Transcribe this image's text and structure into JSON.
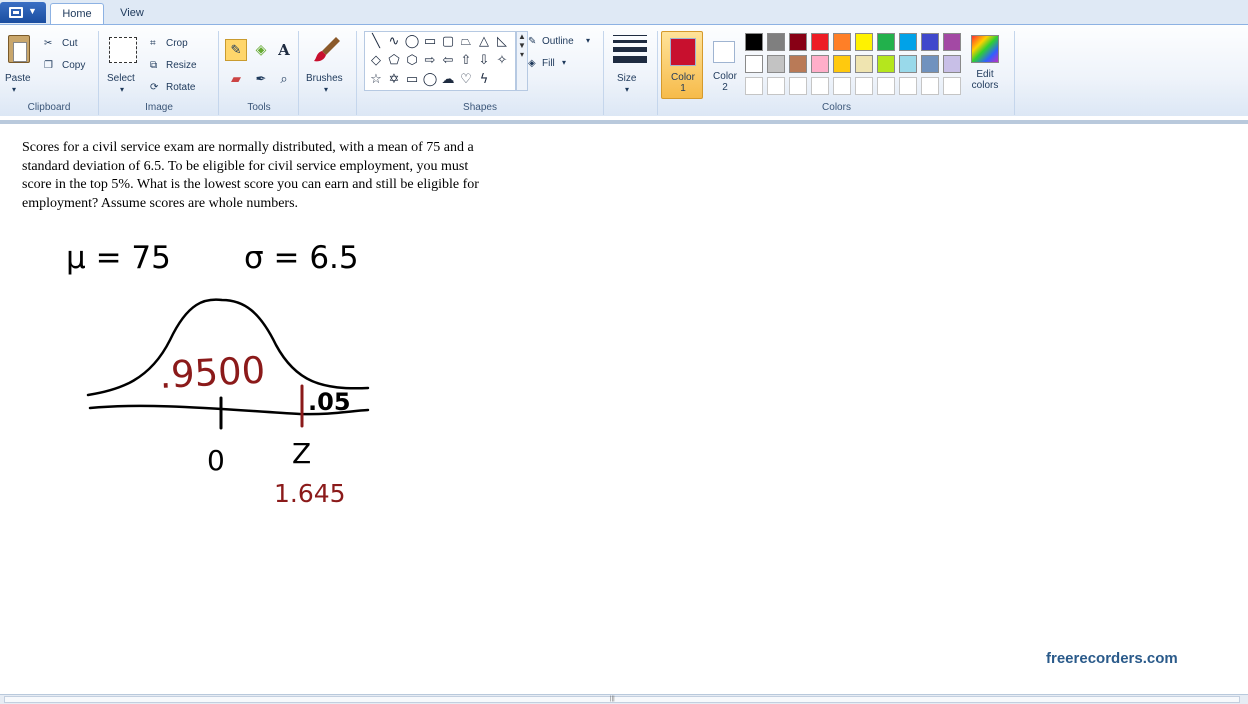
{
  "ribbon": {
    "tabs": {
      "home": "Home",
      "view": "View"
    },
    "clipboard": {
      "group_label": "Clipboard",
      "paste": "Paste",
      "cut": "Cut",
      "copy": "Copy"
    },
    "image": {
      "group_label": "Image",
      "select": "Select",
      "crop": "Crop",
      "resize": "Resize",
      "rotate": "Rotate"
    },
    "tools": {
      "group_label": "Tools",
      "text_tool": "A"
    },
    "brushes": {
      "label": "Brushes"
    },
    "shapes": {
      "group_label": "Shapes",
      "outline": "Outline",
      "fill": "Fill"
    },
    "size": {
      "label": "Size"
    },
    "colors": {
      "group_label": "Colors",
      "color1_label": "Color 1",
      "color2_label": "Color 2",
      "edit_colors": "Edit colors",
      "color1": "#c8102e",
      "color2": "#ffffff",
      "palette_row1": [
        "#000000",
        "#7f7f7f",
        "#880015",
        "#ed1c24",
        "#ff7f27",
        "#fff200",
        "#22b14c",
        "#00a2e8",
        "#3f48cc",
        "#a349a4"
      ],
      "palette_row2": [
        "#ffffff",
        "#c3c3c3",
        "#b97a57",
        "#ffaec9",
        "#ffc90e",
        "#efe4b0",
        "#b5e61d",
        "#99d9ea",
        "#7092be",
        "#c8bfe7"
      ]
    }
  },
  "canvas": {
    "problem_text": "Scores for a civil service exam are normally distributed, with a mean of 75 and a standard deviation of 6.5.  To be eligible for civil service employment, you must score in the top 5%. What is the lowest score you can earn and still be eligible for employment? Assume scores are whole numbers.",
    "handwriting": {
      "mu_eq": "μ = 75",
      "sigma_eq": "σ = 6.5",
      "area_left": ".9500",
      "area_right": ".05",
      "zero_label": "0",
      "z_label": "Z",
      "z_value": "1.645"
    }
  },
  "watermark": "freerecorders.com"
}
